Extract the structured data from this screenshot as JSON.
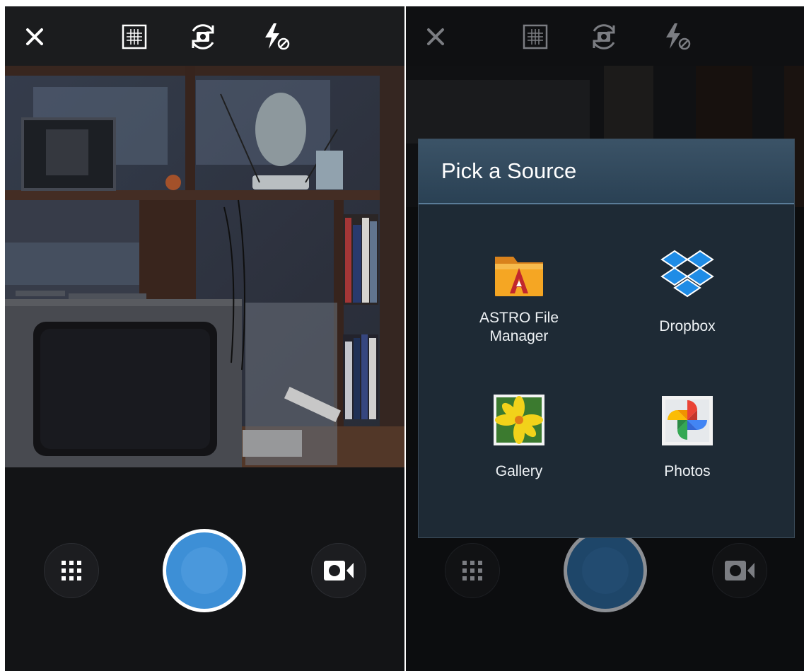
{
  "screens": {
    "camera": {
      "toolbar": [
        "close-icon",
        "grid-icon",
        "switch-camera-icon",
        "flash-off-icon"
      ],
      "controls": [
        "apps-grid-icon",
        "shutter-button",
        "video-camera-icon"
      ],
      "accent": "#3d8fd6"
    },
    "picker": {
      "dialog": {
        "title": "Pick a Source",
        "items": [
          {
            "label": "ASTRO File Manager",
            "label_lines": [
              "ASTRO File",
              "Manager"
            ],
            "icon": "astro-folder-icon"
          },
          {
            "label": "Dropbox",
            "icon": "dropbox-icon"
          },
          {
            "label": "Gallery",
            "icon": "gallery-icon"
          },
          {
            "label": "Photos",
            "icon": "photos-pinwheel-icon"
          }
        ]
      }
    }
  }
}
